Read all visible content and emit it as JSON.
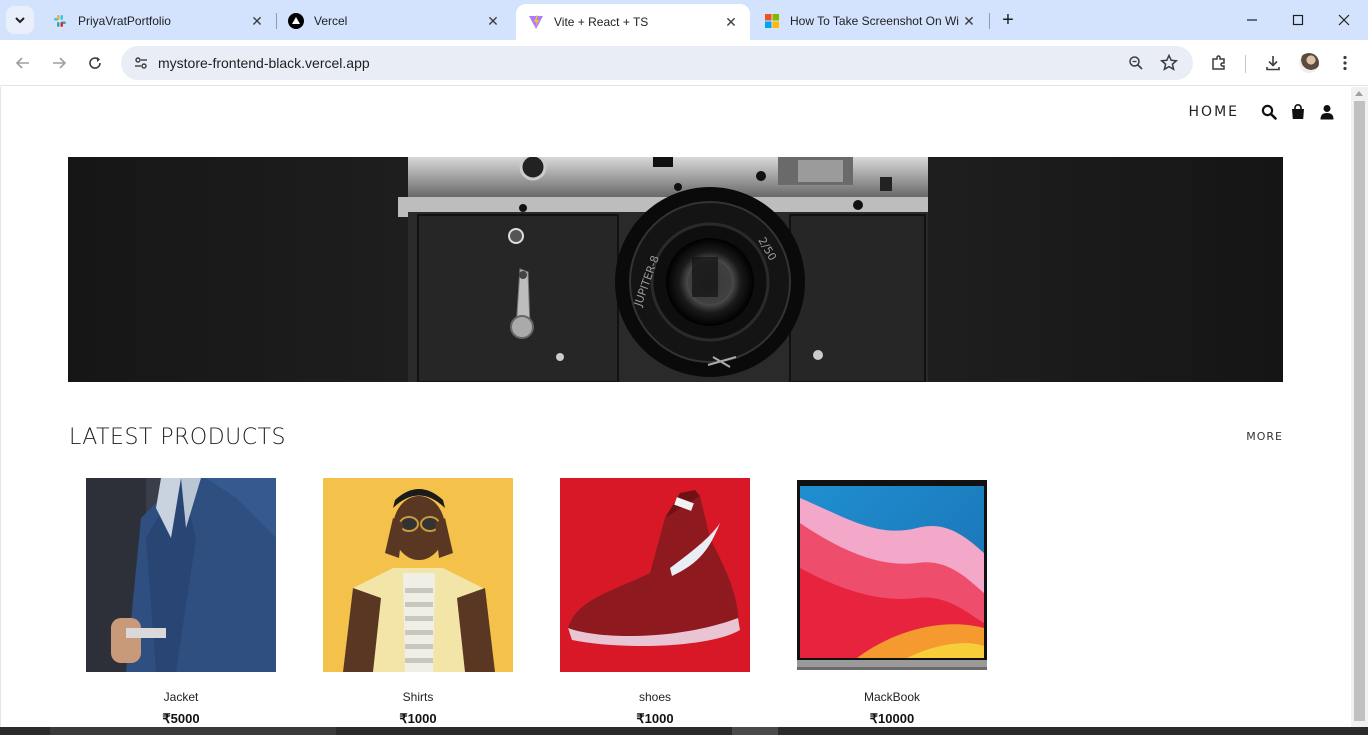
{
  "browser": {
    "tabs": [
      {
        "title": "PriyaVratPortfolio",
        "icon": "slack-like-icon",
        "active": false
      },
      {
        "title": "Vercel",
        "icon": "vercel-icon",
        "active": false
      },
      {
        "title": "Vite + React + TS",
        "icon": "vite-icon",
        "active": true
      },
      {
        "title": "How To Take Screenshot On Wi",
        "icon": "windows-icon",
        "active": false
      }
    ],
    "url": "mystore-frontend-black.vercel.app"
  },
  "site": {
    "nav": {
      "home_label": "HOME"
    },
    "section": {
      "title": "LATEST PRODUCTS",
      "more_label": "MORE"
    },
    "products": [
      {
        "name": "Jacket",
        "price": "₹5000",
        "image": "man in blue suit jacket"
      },
      {
        "name": "Shirts",
        "price": "₹1000",
        "image": "man in yellow shirt with sunglasses"
      },
      {
        "name": "shoes",
        "price": "₹1000",
        "image": "red nike sneaker"
      },
      {
        "name": "MackBook",
        "price": "₹10000",
        "image": "macbook laptop with colorful wallpaper"
      }
    ]
  },
  "colors": {
    "tabbar_bg": "#d3e3fd",
    "omnibox_bg": "#e9eef6",
    "hero_bg": "#1b1b1b"
  }
}
